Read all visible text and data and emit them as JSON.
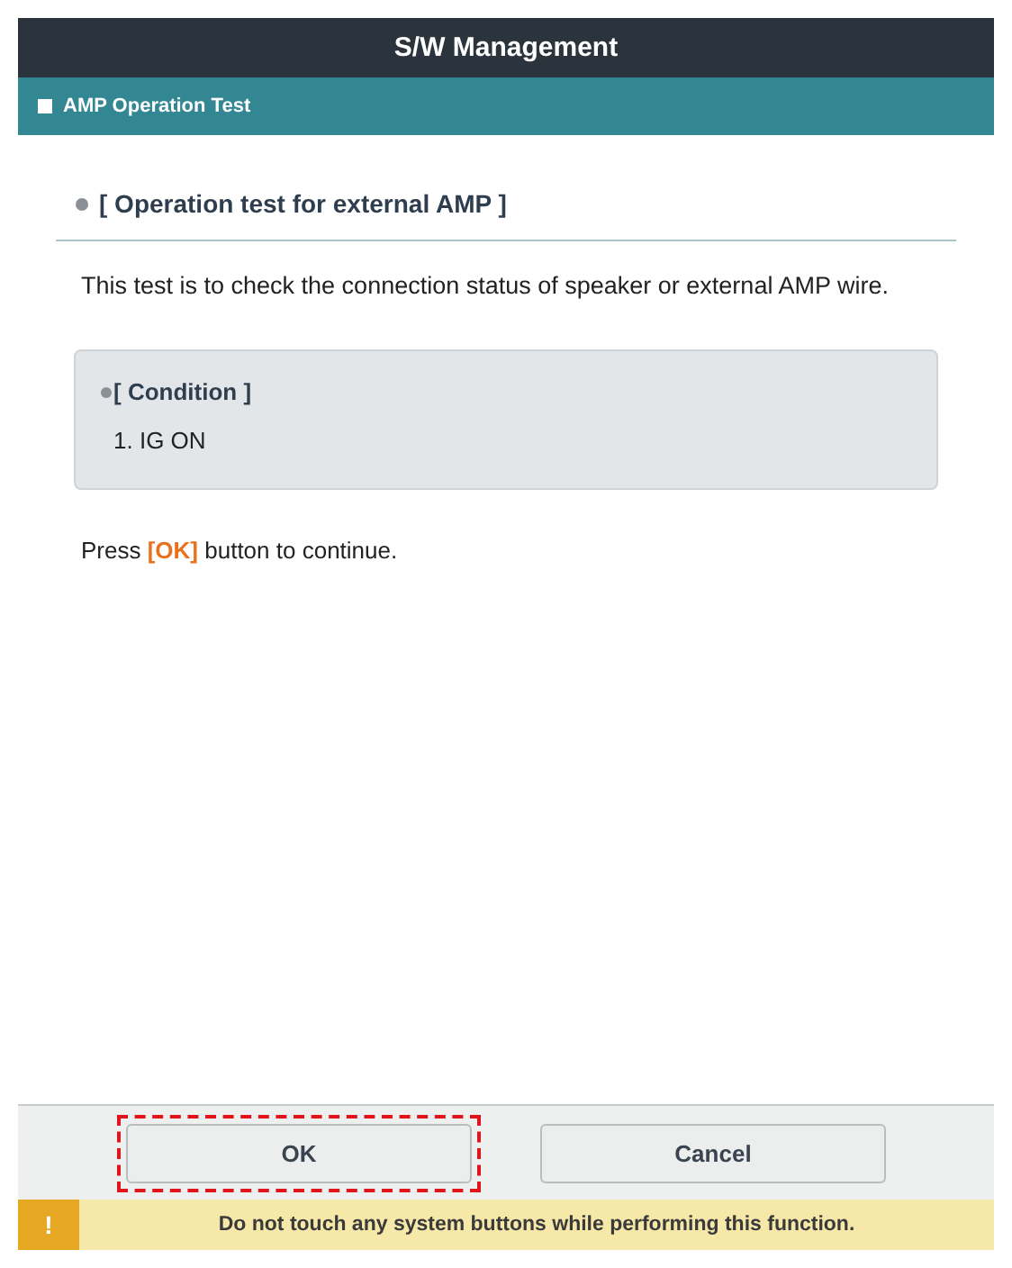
{
  "window": {
    "title": "S/W Management"
  },
  "section_bar": {
    "title": "AMP Operation Test"
  },
  "content": {
    "heading": "[ Operation test for external AMP ]",
    "description": "This test is to check the connection status of speaker or external AMP wire.",
    "condition": {
      "title": "[ Condition ]",
      "items": [
        "1. IG ON"
      ]
    },
    "instruction": "Press **[OK]** button to continue."
  },
  "buttons": [
    {
      "label": "OK",
      "highlighted": true
    },
    {
      "label": "Cancel",
      "highlighted": false
    }
  ],
  "warning": {
    "icon": "!",
    "text": "Do not touch any system buttons while performing this function."
  }
}
